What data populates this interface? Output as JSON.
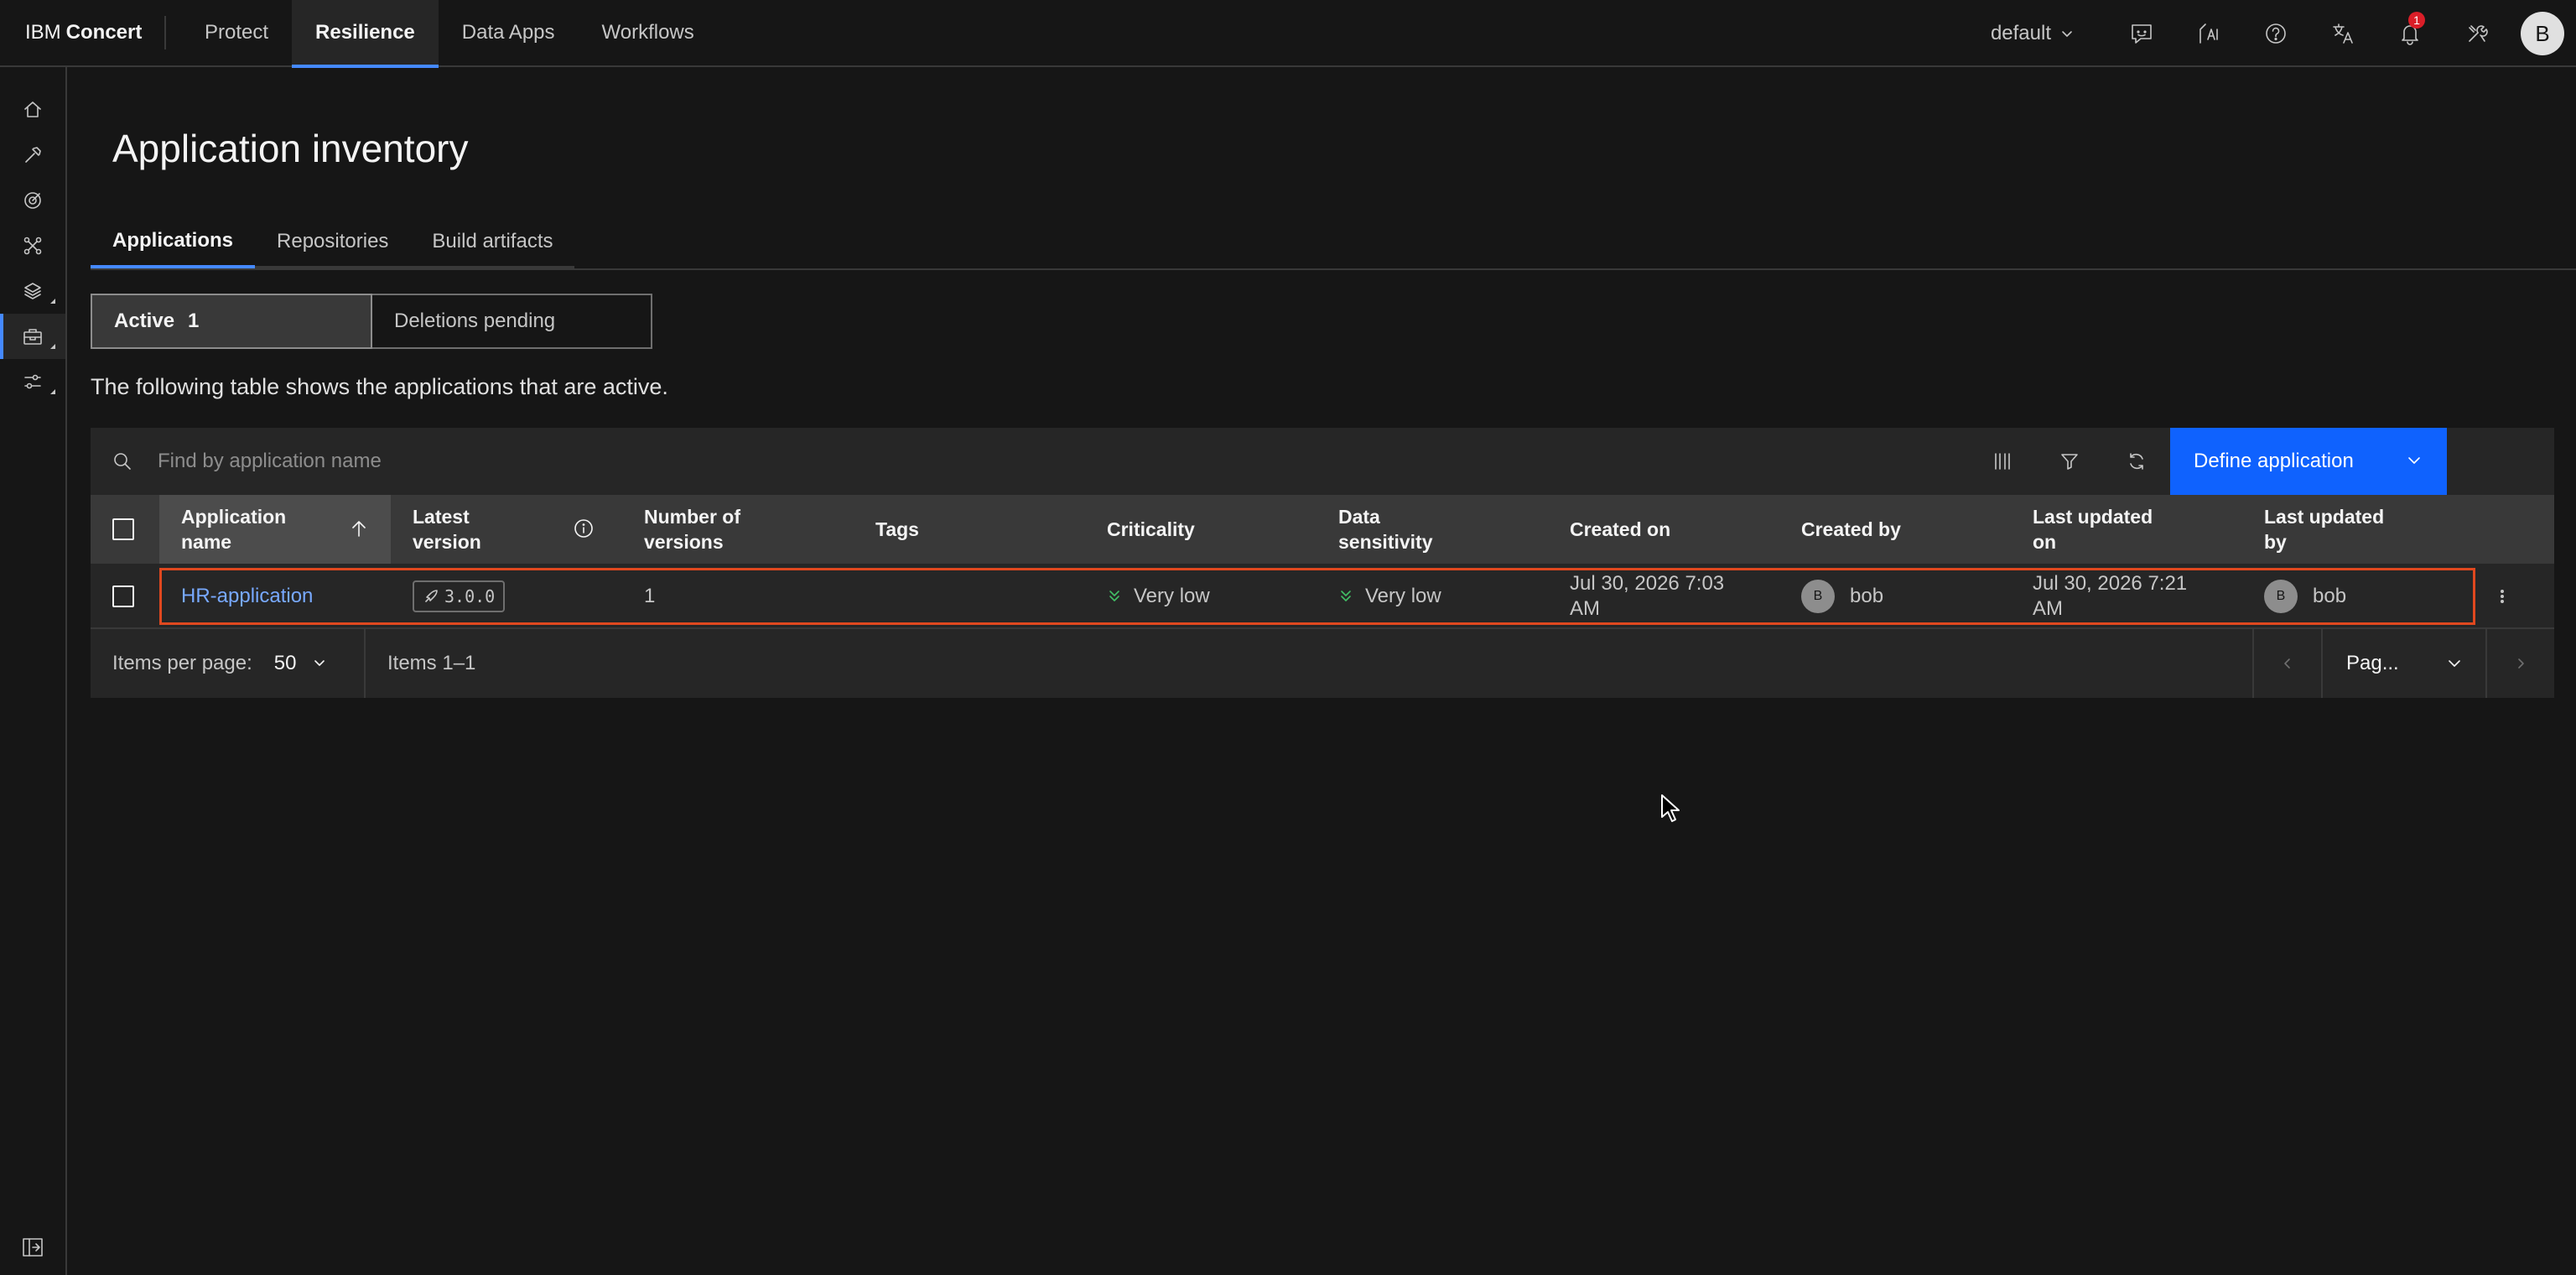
{
  "app": {
    "brand_prefix": "IBM",
    "brand_name": "Concert"
  },
  "nav": {
    "protect": "Protect",
    "resilience": "Resilience",
    "data_apps": "Data Apps",
    "workflows": "Workflows"
  },
  "header": {
    "tenant": "default",
    "notification_count": "1",
    "user_initial": "B"
  },
  "page": {
    "title": "Application inventory"
  },
  "tabs": {
    "applications": "Applications",
    "repositories": "Repositories",
    "build_artifacts": "Build artifacts"
  },
  "switcher": {
    "active_label": "Active",
    "active_count": "1",
    "deletions_label": "Deletions pending"
  },
  "description": "The following table shows the applications that are active.",
  "toolbar": {
    "search_placeholder": "Find by application name",
    "define_label": "Define application"
  },
  "table": {
    "headers": {
      "app_name_1": "Application",
      "app_name_2": "name",
      "latest_version_1": "Latest",
      "latest_version_2": "version",
      "num_versions_1": "Number of",
      "num_versions_2": "versions",
      "tags": "Tags",
      "criticality": "Criticality",
      "data_sensitivity_1": "Data",
      "data_sensitivity_2": "sensitivity",
      "created_on": "Created on",
      "created_by": "Created by",
      "last_updated_on_1": "Last updated",
      "last_updated_on_2": "on",
      "last_updated_by_1": "Last updated",
      "last_updated_by_2": "by"
    },
    "rows": [
      {
        "name": "HR-application",
        "version": "3.0.0",
        "num_versions": "1",
        "tags": "",
        "criticality": "Very low",
        "data_sensitivity": "Very low",
        "created_on_1": "Jul 30, 2026 7:03",
        "created_on_2": "AM",
        "created_by_initial": "B",
        "created_by": "bob",
        "updated_on_1": "Jul 30, 2026 7:21",
        "updated_on_2": "AM",
        "updated_by_initial": "B",
        "updated_by": "bob"
      }
    ]
  },
  "pagination": {
    "items_per_page_label": "Items per page:",
    "items_per_page": "50",
    "range": "Items 1–1",
    "page_select": "Pag..."
  },
  "colors": {
    "accent": "#0f62fe",
    "link": "#78a9ff",
    "highlight": "#e0481f",
    "success": "#42be65"
  }
}
